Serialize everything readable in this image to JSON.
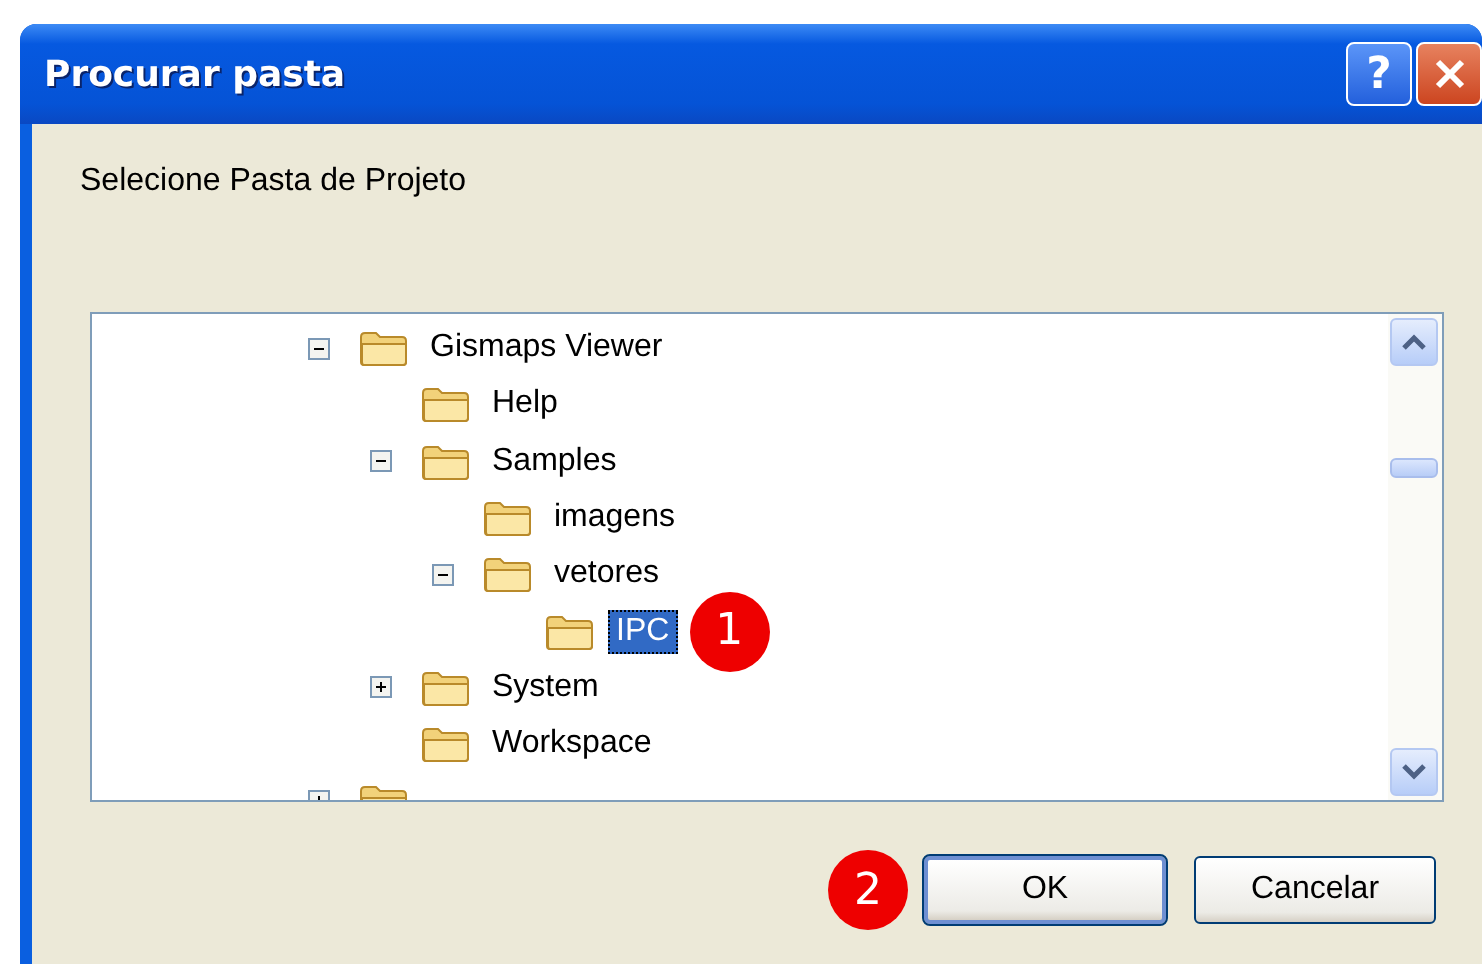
{
  "window": {
    "title": "Procurar pasta",
    "help_button": {
      "label": "?"
    }
  },
  "instruction": "Selecione Pasta de Projeto",
  "tree": {
    "items": [
      {
        "label": "Gismaps Viewer",
        "kind": "expandable",
        "expanded": true,
        "selected": false,
        "children": [
          {
            "label": "Help",
            "kind": "leaf",
            "selected": false
          },
          {
            "label": "Samples",
            "kind": "expandable",
            "expanded": true,
            "selected": false,
            "children": [
              {
                "label": "imagens",
                "kind": "leaf",
                "selected": false
              },
              {
                "label": "vetores",
                "kind": "expandable",
                "expanded": true,
                "selected": false,
                "children": [
                  {
                    "label": "IPC",
                    "kind": "leaf",
                    "selected": true,
                    "callout": "1"
                  }
                ]
              }
            ]
          },
          {
            "label": "System",
            "kind": "expandable",
            "expanded": false,
            "selected": false
          },
          {
            "label": "Workspace",
            "kind": "leaf",
            "selected": false
          }
        ]
      },
      {
        "kind": "expandable",
        "expanded": false
      }
    ]
  },
  "buttons": [
    {
      "label": "OK",
      "default": true,
      "callout": "2"
    },
    {
      "label": "Cancelar",
      "default": false
    }
  ]
}
